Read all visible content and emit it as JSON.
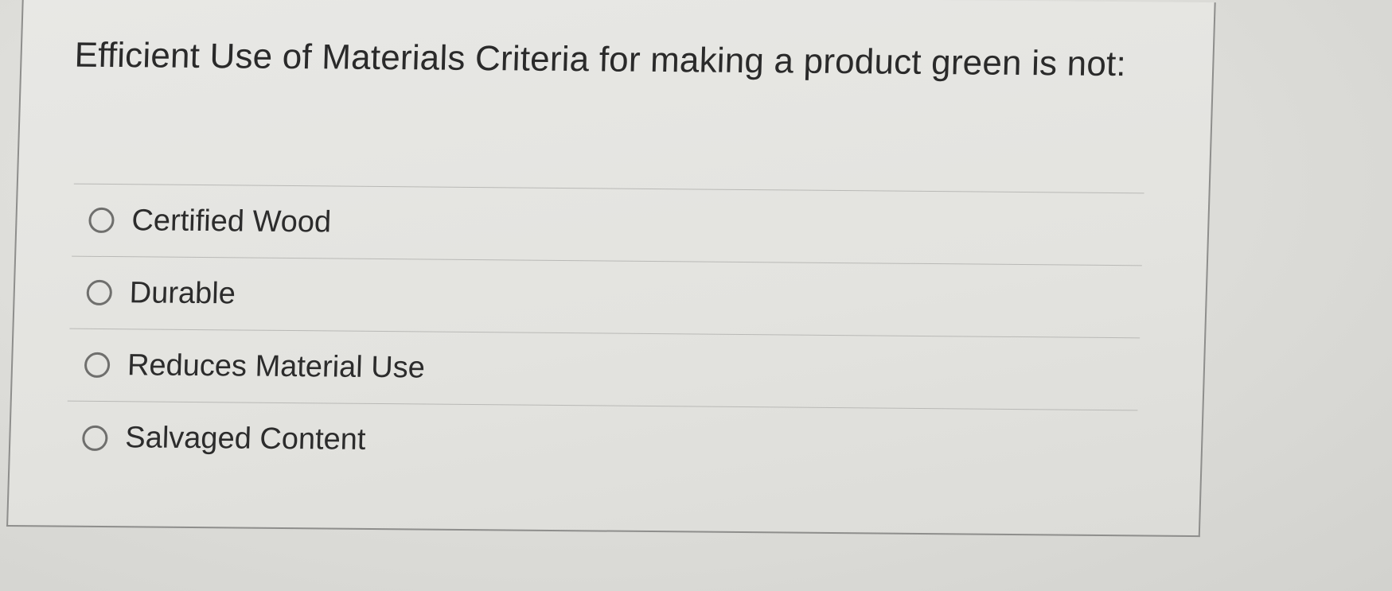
{
  "question": {
    "text": "Efficient Use of Materials Criteria for making a product green is not:"
  },
  "options": [
    {
      "label": "Certified Wood",
      "selected": false
    },
    {
      "label": "Durable",
      "selected": false
    },
    {
      "label": "Reduces Material Use",
      "selected": false
    },
    {
      "label": "Salvaged Content",
      "selected": false
    }
  ]
}
